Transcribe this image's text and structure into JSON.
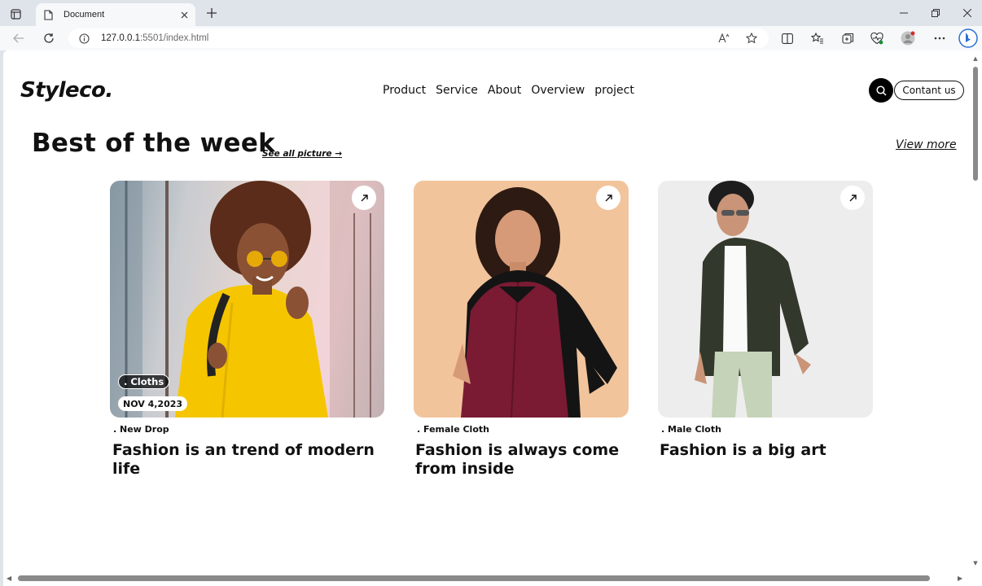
{
  "browser": {
    "tab_title": "Document",
    "url_host": "127.0.0.1",
    "url_rest": ":5501/index.html"
  },
  "site": {
    "logo": "Styleco.",
    "nav": [
      "Product",
      "Service",
      "About",
      "Overview",
      "project"
    ],
    "contact_label": "Contant us"
  },
  "section": {
    "title": "Best of the week",
    "see_all": "See all picture →",
    "view_more": "View more"
  },
  "cards": [
    {
      "category": ". New Drop",
      "title_line1": "Fashion is an trend of modern",
      "title_line2": "life",
      "tag": ". Cloths",
      "date": "NOV 4,2023"
    },
    {
      "category": ". Female Cloth",
      "title_line1": "Fashion is always come",
      "title_line2": "from inside"
    },
    {
      "category": ". Male Cloth",
      "title_line1": "Fashion is a big art",
      "title_line2": ""
    }
  ],
  "icons": {
    "card_arrow": "arrow-up-right-icon",
    "search": "search-icon"
  },
  "colors": {
    "accent": "#000000",
    "chrome": "#dfe3ea",
    "card1_bg": "#d8cfc4",
    "card2_bg": "#f2c49c",
    "card3_bg": "#eeeeee"
  }
}
